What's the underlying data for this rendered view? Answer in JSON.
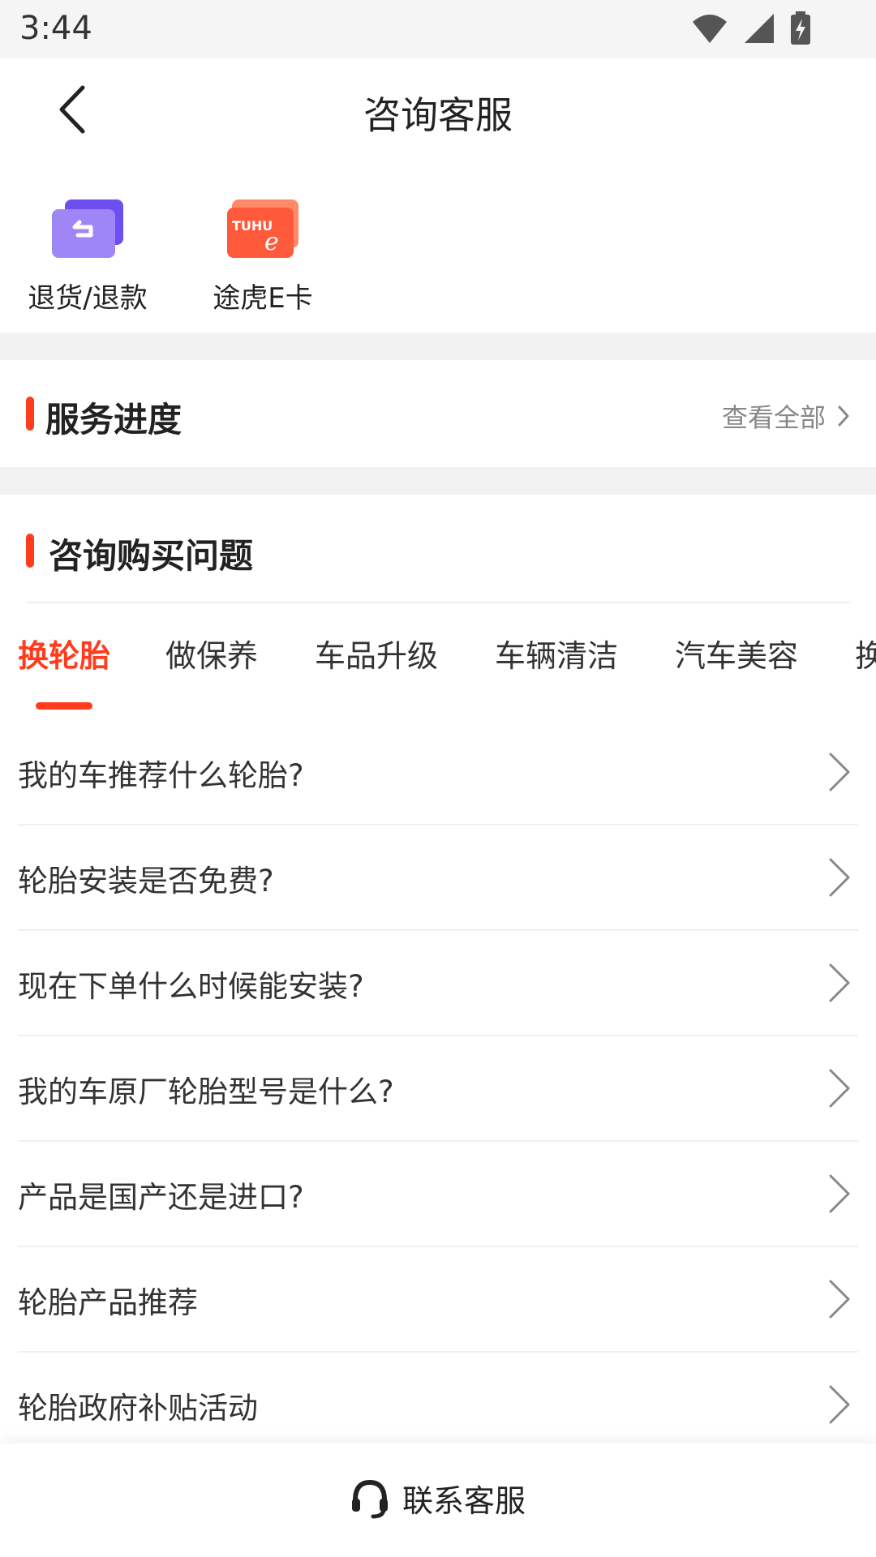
{
  "status_bar": {
    "time": "3:44"
  },
  "header": {
    "title": "咨询客服"
  },
  "quick_actions": [
    {
      "label": "退货/退款",
      "icon": "return-refund-icon"
    },
    {
      "label": "途虎E卡",
      "icon": "tuhu-ecard-icon",
      "logo_text": "TUHU"
    }
  ],
  "service_progress": {
    "title": "服务进度",
    "view_all": "查看全部"
  },
  "consult": {
    "title": "咨询购买问题",
    "tabs": [
      "换轮胎",
      "做保养",
      "车品升级",
      "车辆清洁",
      "汽车美容",
      "换"
    ],
    "active_tab": 0,
    "questions": [
      "我的车推荐什么轮胎?",
      "轮胎安装是否免费?",
      "现在下单什么时候能安装?",
      "我的车原厂轮胎型号是什么?",
      "产品是国产还是进口?",
      "轮胎产品推荐",
      "轮胎政府补贴活动"
    ]
  },
  "bottom_bar": {
    "contact_label": "联系客服"
  },
  "colors": {
    "accent": "#ff3c1e",
    "purple": "#7b5cf0",
    "orange": "#ff6a4a"
  }
}
